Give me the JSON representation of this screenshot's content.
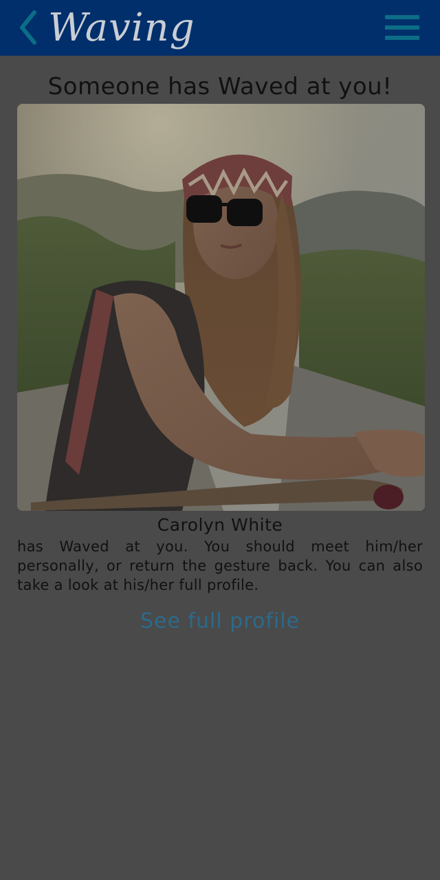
{
  "header": {
    "title": "Waving",
    "back_icon": "chevron-left-icon",
    "menu_icon": "hamburger-menu-icon"
  },
  "heading": "Someone has Waved at you!",
  "profile": {
    "name": "Carolyn White",
    "message": "has Waved at you. You should meet him/her personally, or return the gesture back. You can also take a look at his/her full profile.",
    "link_label": "See full profile"
  },
  "colors": {
    "header_bg": "#012f6c",
    "accent": "#0c6d86",
    "page_bg": "#4a4a4a",
    "link": "#2c6a8a"
  }
}
